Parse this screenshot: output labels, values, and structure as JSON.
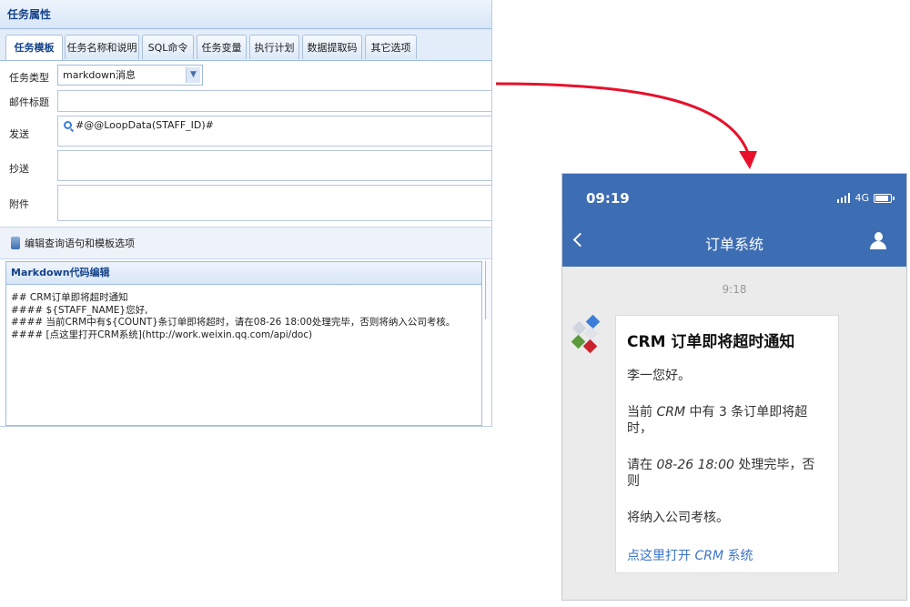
{
  "desktop": {
    "panel_title": "任务属性",
    "tabs": [
      {
        "label": "任务模板",
        "active": true
      },
      {
        "label": "任务名称和说明",
        "active": false
      },
      {
        "label": "SQL命令",
        "active": false
      },
      {
        "label": "任务变量",
        "active": false
      },
      {
        "label": "执行计划",
        "active": false
      },
      {
        "label": "数据提取码",
        "active": false
      },
      {
        "label": "其它选项",
        "active": false
      }
    ],
    "fields": {
      "task_type_label": "任务类型",
      "task_type_value": "markdown消息",
      "mail_title_label": "邮件标题",
      "mail_title_value": "",
      "send_label": "发送",
      "send_value": "#@@LoopData(STAFF_ID)#",
      "cc_label": "抄送",
      "cc_value": "",
      "attachment_label": "附件",
      "attachment_value": ""
    },
    "toolbar_button": "编辑查询语句和模板选项",
    "markdown_editor": {
      "title": "Markdown代码编辑",
      "lines": [
        "## CRM订单即将超时通知",
        "#### ${STAFF_NAME}您好,",
        "#### 当前CRM中有${COUNT}条订单即将超时，请在08-26 18:00处理完毕，否则将纳入公司考核。",
        "#### [点这里打开CRM系统](http://work.weixin.qq.com/api/doc)"
      ]
    }
  },
  "phone": {
    "status_time": "09:19",
    "network": "4G",
    "nav_title": "订单系统",
    "message_time": "9:18",
    "message": {
      "title": "CRM 订单即将超时通知",
      "greeting": "李一您好。",
      "line1_a": "当前 ",
      "line1_b": "CRM",
      "line1_c": " 中有 3 条订单即将超时，",
      "line2_a": "请在 ",
      "line2_b": "08-26 18:00",
      "line2_c": " 处理完毕，否则",
      "line3": "将纳入公司考核。",
      "link_a": "点这里打开 ",
      "link_b": "CRM",
      "link_c": " 系统"
    }
  },
  "colors": {
    "phone_header": "#3d6db3",
    "arrow": "#e8102a",
    "link": "#3b74c8",
    "panel_title_text": "#15428b"
  }
}
